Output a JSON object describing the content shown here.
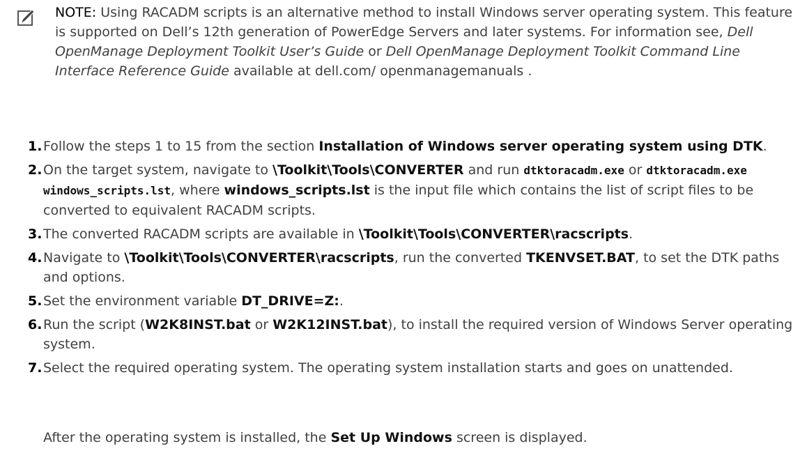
{
  "note": {
    "label": "NOTE:",
    "t1": "Using RACADM scripts is an alternative method to install Windows server operating system. This feature is supported on Dell’s 12th generation of PowerEdge Servers and later systems. For information see,",
    "guide1": "Dell OpenManage Deployment Toolkit User’s Guide",
    "or": "or",
    "guide2": "Dell OpenManage Deployment Toolkit Command Line Interface Reference Guide",
    "t2": "available at dell.com/ openmanagemanuals ."
  },
  "steps": [
    {
      "num": "1.",
      "a": "Follow the steps 1 to 15 from the section",
      "b": "Installation of Windows server operating system using DTK",
      "c": "."
    },
    {
      "num": "2.",
      "a": "On the target system, navigate to",
      "b": "\\Toolkit\\Tools\\CONVERTER",
      "c": "and run",
      "m1": "dtktoracadm.exe",
      "d": "or",
      "m2": "dtktoracadm.exe windows_scripts.lst",
      "e": ", where",
      "f": "windows_scripts.lst",
      "g": "is the input file which contains the list of script files to be converted to equivalent RACADM scripts."
    },
    {
      "num": "3.",
      "a": "The converted RACADM scripts are available in",
      "b": "\\Toolkit\\Tools\\CONVERTER\\racscripts",
      "c": "."
    },
    {
      "num": "4.",
      "a": "Navigate to",
      "b": "\\Toolkit\\Tools\\CONVERTER\\racscripts",
      "c": ", run the converted",
      "d": "TKENVSET.BAT",
      "e": ", to set the DTK paths and options."
    },
    {
      "num": "5.",
      "a": "Set the environment variable",
      "b": "DT_DRIVE=Z:",
      "c": "."
    },
    {
      "num": "6.",
      "a": "Run the script (",
      "b": "W2K8INST.bat",
      "c": "or",
      "d": "W2K12INST.bat",
      "e": "), to install the required version of Windows Server operating system."
    },
    {
      "num": "7.",
      "a": "Select the required operating system. The operating system installation starts and goes on unattended."
    }
  ],
  "followup": {
    "a": "After the operating system is installed, the",
    "b": "Set Up Windows",
    "c": "screen is displayed."
  }
}
